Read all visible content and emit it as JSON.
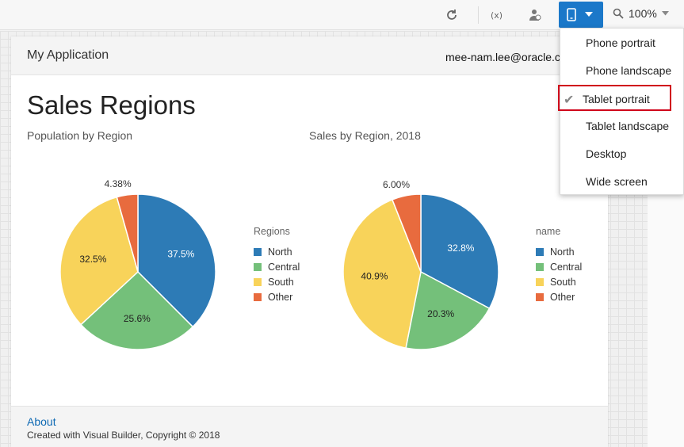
{
  "toolbar": {
    "zoom_value": "100%",
    "icons": [
      "refresh-icon",
      "variables-icon",
      "user-roles-icon",
      "device-phone-icon",
      "chevron-down-icon",
      "zoom-icon"
    ]
  },
  "device_menu": {
    "items": [
      {
        "label": "Phone portrait",
        "selected": false
      },
      {
        "label": "Phone landscape",
        "selected": false
      },
      {
        "label": "Tablet portrait",
        "selected": true
      },
      {
        "label": "Tablet landscape",
        "selected": false
      },
      {
        "label": "Desktop",
        "selected": false
      },
      {
        "label": "Wide screen",
        "selected": false
      }
    ]
  },
  "app": {
    "title": "My Application",
    "user": "mee-nam.lee@oracle.c",
    "page_title": "Sales Regions",
    "footer": {
      "about": "About",
      "copyright": "Created with Visual Builder, Copyright © 2018"
    }
  },
  "colors": {
    "accent": "#1b78c9",
    "north": "#2d7bb6",
    "central": "#74c07a",
    "south": "#f8d35a",
    "other": "#e86b3e",
    "selection_outline": "#d0021b"
  },
  "chart_data": [
    {
      "type": "pie",
      "title": "Population by Region",
      "legend_title": "Regions",
      "categories": [
        "North",
        "Central",
        "South",
        "Other"
      ],
      "values": [
        37.5,
        25.6,
        32.5,
        4.38
      ],
      "labels": [
        "37.5%",
        "25.6%",
        "32.5%",
        "4.38%"
      ],
      "legend_position": "right"
    },
    {
      "type": "pie",
      "title": "Sales by Region, 2018",
      "legend_title": "name",
      "categories": [
        "North",
        "Central",
        "South",
        "Other"
      ],
      "values": [
        32.8,
        20.3,
        40.9,
        6.0
      ],
      "labels": [
        "32.8%",
        "20.3%",
        "40.9%",
        "6.00%"
      ],
      "legend_position": "right"
    }
  ]
}
